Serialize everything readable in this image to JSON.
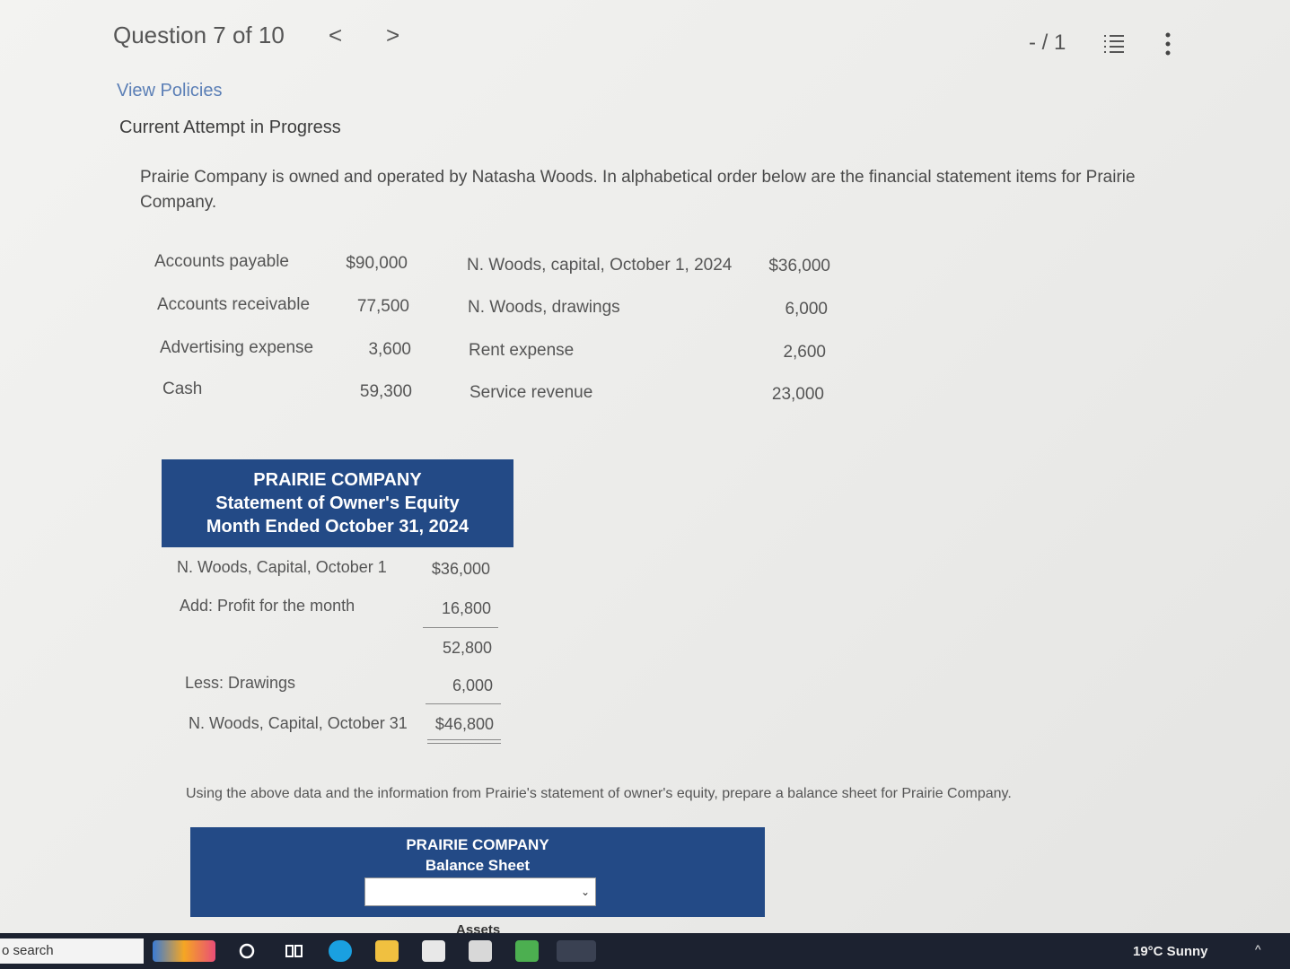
{
  "header": {
    "question": "Question 7 of 10",
    "prev": "<",
    "next": ">",
    "score": "- / 1"
  },
  "view_policies": "View Policies",
  "attempt": "Current Attempt in Progress",
  "intro": "Prairie Company is owned and operated by Natasha Woods. In alphabetical order below are the financial statement items for Prairie Company.",
  "items_left": [
    {
      "label": "Accounts payable",
      "amount": "$90,000"
    },
    {
      "label": "Accounts receivable",
      "amount": "77,500"
    },
    {
      "label": "Advertising expense",
      "amount": "3,600"
    },
    {
      "label": "Cash",
      "amount": "59,300"
    }
  ],
  "items_right": [
    {
      "label": "N. Woods, capital, October 1, 2024",
      "amount": "$36,000"
    },
    {
      "label": "N. Woods, drawings",
      "amount": "6,000"
    },
    {
      "label": "Rent expense",
      "amount": "2,600"
    },
    {
      "label": "Service revenue",
      "amount": "23,000"
    }
  ],
  "equity_statement": {
    "company": "PRAIRIE COMPANY",
    "title": "Statement of Owner's Equity",
    "period": "Month Ended October 31, 2024",
    "rows": [
      {
        "label": "N. Woods, Capital, October 1",
        "amount": "$36,000"
      },
      {
        "label": "Add: Profit for the month",
        "amount": "16,800"
      },
      {
        "label": "",
        "amount": "52,800"
      },
      {
        "label": "Less: Drawings",
        "amount": "6,000"
      },
      {
        "label": "N. Woods, Capital, October 31",
        "amount": "$46,800"
      }
    ]
  },
  "instruction": "Using the above data and the information from Prairie's statement of owner's equity, prepare a balance sheet for Prairie Company.",
  "balance_sheet": {
    "company": "PRAIRIE COMPANY",
    "title": "Balance Sheet",
    "date_select": "",
    "section_partial": "Assets"
  },
  "taskbar": {
    "search": "o search",
    "weather": "19°C  Sunny"
  },
  "colors": {
    "header_blue": "#234a86",
    "link_blue": "#5b7fb6"
  }
}
